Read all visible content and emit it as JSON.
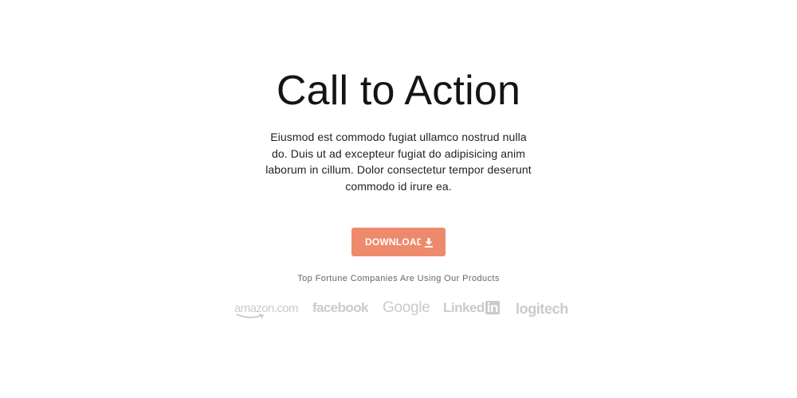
{
  "hero": {
    "title": "Call to Action",
    "description": "Eiusmod est commodo fugiat ullamco nostrud nulla do. Duis ut ad excepteur fugiat do adipisicing anim laborum in cillum. Dolor consectetur tempor deserunt commodo id irure ea.",
    "button_label": "DOWNLOAD",
    "button_icon": "download-icon",
    "button_color": "#ee8a6c"
  },
  "trust": {
    "text": "Top Fortune Companies Are Using Our Products",
    "logo_color": "#cbcbcb",
    "logos": {
      "amazon": "amazon.com",
      "facebook": "facebook",
      "google": "Google",
      "linkedin_text": "Linked",
      "linkedin_box": "in",
      "logitech": "logitech"
    }
  }
}
